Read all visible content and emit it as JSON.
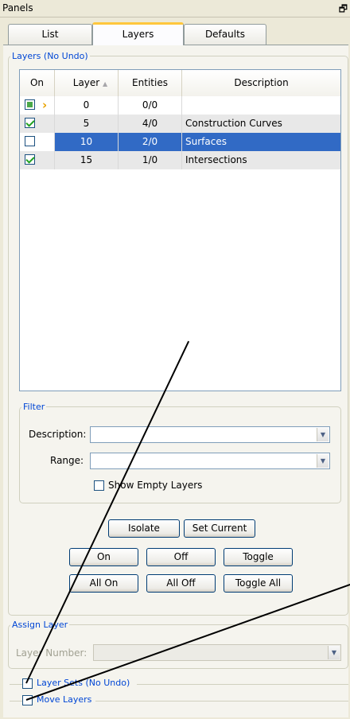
{
  "panel": {
    "title": "Panels",
    "pin_icon": "pin-icon"
  },
  "tabs": [
    {
      "label": "List",
      "active": false
    },
    {
      "label": "Layers",
      "active": true
    },
    {
      "label": "Defaults",
      "active": false
    }
  ],
  "layers_group": {
    "legend": "Layers (No Undo)",
    "columns": [
      "On",
      "Layer",
      "Entities",
      "Description"
    ],
    "rows": [
      {
        "on": "partial",
        "current": true,
        "layer": "0",
        "entities": "0/0",
        "description": ""
      },
      {
        "on": "checked",
        "current": false,
        "layer": "5",
        "entities": "4/0",
        "description": "Construction Curves"
      },
      {
        "on": "unchecked",
        "current": false,
        "layer": "10",
        "entities": "2/0",
        "description": "Surfaces"
      },
      {
        "on": "checked",
        "current": false,
        "layer": "15",
        "entities": "1/0",
        "description": "Intersections"
      }
    ]
  },
  "filter": {
    "legend": "Filter",
    "description_label": "Description:",
    "description_value": "",
    "range_label": "Range:",
    "range_value": "",
    "show_empty_label": "Show Empty Layers"
  },
  "buttons": {
    "isolate": "Isolate",
    "set_current": "Set Current",
    "on": "On",
    "off": "Off",
    "toggle": "Toggle",
    "all_on": "All On",
    "all_off": "All Off",
    "toggle_all": "Toggle All"
  },
  "assign": {
    "legend": "Assign Layer",
    "layer_number_label": "Layer Number:",
    "layer_number_value": ""
  },
  "layer_sets": {
    "label": "Layer Sets (No Undo)"
  },
  "move_layers": {
    "label": "Move Layers"
  },
  "colors": {
    "selection": "#316ac5",
    "accent": "#0046d5",
    "tab_highlight": "#ffc73c"
  }
}
